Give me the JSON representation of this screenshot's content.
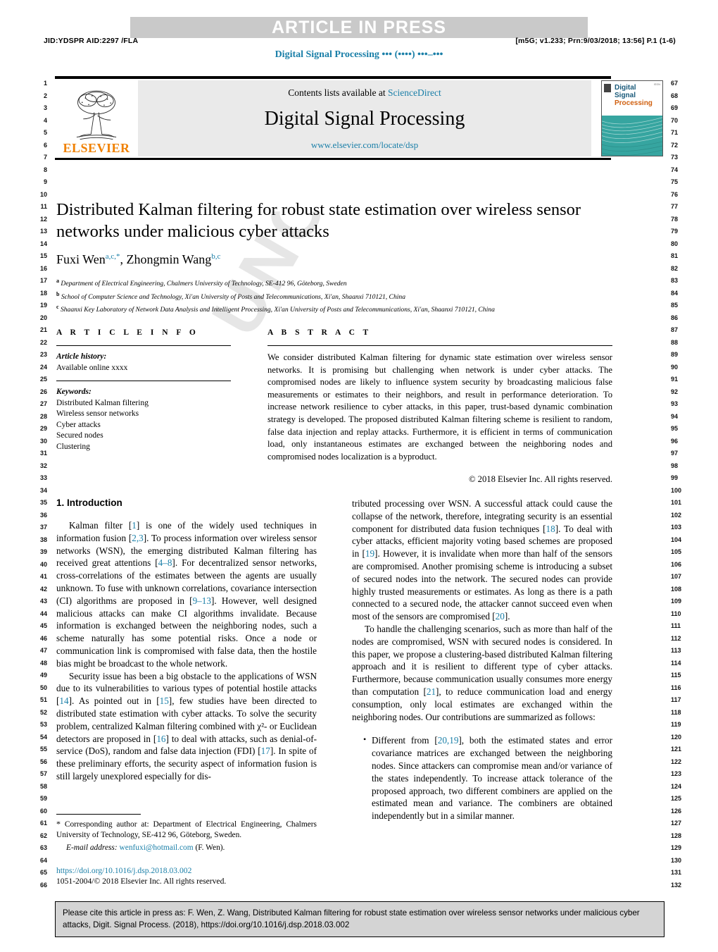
{
  "header": {
    "banner": "ARTICLE IN PRESS",
    "jid": "JID:YDSPR   AID:2297 /FLA",
    "prn": "[m5G; v1.233; Prn:9/03/2018; 13:56] P.1 (1-6)",
    "running_journal": "Digital Signal Processing ••• (••••) •••–•••"
  },
  "masthead": {
    "contents_prefix": "Contents lists available at ",
    "contents_link": "ScienceDirect",
    "journal_title": "Digital Signal Processing",
    "journal_url": "www.elsevier.com/locate/dsp",
    "publisher": "ELSEVIER",
    "cover_title_line1": "Digital",
    "cover_title_line2": "Signal",
    "cover_title_line3": "Processing",
    "cover_tag": "ISSN"
  },
  "title": "Distributed Kalman filtering for robust state estimation over wireless sensor networks under malicious cyber attacks",
  "authors": {
    "author1": "Fuxi Wen",
    "author1_sup": "a,c,*",
    "separator": ", ",
    "author2": "Zhongmin Wang",
    "author2_sup": "b,c"
  },
  "affiliations": [
    {
      "mark": "a",
      "text": "Department of Electrical Engineering, Chalmers University of Technology, SE-412 96, Göteborg, Sweden"
    },
    {
      "mark": "b",
      "text": "School of Computer Science and Technology, Xi'an University of Posts and Telecommunications, Xi'an, Shaanxi 710121, China"
    },
    {
      "mark": "c",
      "text": "Shaanxi Key Laboratory of Network Data Analysis and Intelligent Processing, Xi'an University of Posts and Telecommunications, Xi'an, Shaanxi 710121, China"
    }
  ],
  "article_info": {
    "label": "A R T I C L E   I N F O",
    "history_label": "Article history:",
    "history_value": "Available online xxxx",
    "keywords_label": "Keywords:",
    "keywords": [
      "Distributed Kalman filtering",
      "Wireless sensor networks",
      "Cyber attacks",
      "Secured nodes",
      "Clustering"
    ]
  },
  "abstract": {
    "label": "A B S T R A C T",
    "text": "We consider distributed Kalman filtering for dynamic state estimation over wireless sensor networks. It is promising but challenging when network is under cyber attacks. The compromised nodes are likely to influence system security by broadcasting malicious false measurements or estimates to their neighbors, and result in performance deterioration. To increase network resilience to cyber attacks, in this paper, trust-based dynamic combination strategy is developed. The proposed distributed Kalman filtering scheme is resilient to random, false data injection and replay attacks. Furthermore, it is efficient in terms of communication load, only instantaneous estimates are exchanged between the neighboring nodes and compromised nodes localization is a byproduct.",
    "copyright": "© 2018 Elsevier Inc. All rights reserved."
  },
  "body": {
    "section_heading": "1. Introduction",
    "left_paragraphs": [
      "Kalman filter [1] is one of the widely used techniques in information fusion [2,3]. To process information over wireless sensor networks (WSN), the emerging distributed Kalman filtering has received great attentions [4–8]. For decentralized sensor networks, cross-correlations of the estimates between the agents are usually unknown. To fuse with unknown correlations, covariance intersection (CI) algorithms are proposed in [9–13]. However, well designed malicious attacks can make CI algorithms invalidate. Because information is exchanged between the neighboring nodes, such a scheme naturally has some potential risks. Once a node or communication link is compromised with false data, then the hostile bias might be broadcast to the whole network.",
      "Security issue has been a big obstacle to the applications of WSN due to its vulnerabilities to various types of potential hostile attacks [14]. As pointed out in [15], few studies have been directed to distributed state estimation with cyber attacks. To solve the security problem, centralized Kalman filtering combined with χ²- or Euclidean detectors are proposed in [16] to deal with attacks, such as denial-of-service (DoS), random and false data injection (FDI) [17]. In spite of these preliminary efforts, the security aspect of information fusion is still largely unexplored especially for dis-"
    ],
    "right_paragraphs": [
      "tributed processing over WSN. A successful attack could cause the collapse of the network, therefore, integrating security is an essential component for distributed data fusion techniques [18]. To deal with cyber attacks, efficient majority voting based schemes are proposed in [19]. However, it is invalidate when more than half of the sensors are compromised. Another promising scheme is introducing a subset of secured nodes into the network. The secured nodes can provide highly trusted measurements or estimates. As long as there is a path connected to a secured node, the attacker cannot succeed even when most of the sensors are compromised [20].",
      "To handle the challenging scenarios, such as more than half of the nodes are compromised, WSN with secured nodes is considered. In this paper, we propose a clustering-based distributed Kalman filtering approach and it is resilient to different type of cyber attacks. Furthermore, because communication usually consumes more energy than computation [21], to reduce communication load and energy consumption, only local estimates are exchanged within the neighboring nodes. Our contributions are summarized as follows:"
    ],
    "bullets": [
      "Different from [20,19], both the estimated states and error covariance matrices are exchanged between the neighboring nodes. Since attackers can compromise mean and/or variance of the states independently. To increase attack tolerance of the proposed approach, two different combiners are applied on the estimated mean and variance. The combiners are obtained independently but in a similar manner."
    ]
  },
  "footnote": {
    "star": "*",
    "corresponding": "Corresponding author at: Department of Electrical Engineering, Chalmers University of Technology, SE-412 96, Göteborg, Sweden.",
    "email_label": "E-mail address:",
    "email": "wenfuxi@hotmail.com",
    "email_suffix": "(F. Wen).",
    "doi": "https://doi.org/10.1016/j.dsp.2018.03.002",
    "issn": "1051-2004/© 2018 Elsevier Inc. All rights reserved."
  },
  "cite_box": {
    "text": "Please cite this article in press as: F. Wen, Z. Wang, Distributed Kalman filtering for robust state estimation over wireless sensor networks under malicious cyber attacks, Digit. Signal Process. (2018), https://doi.org/10.1016/j.dsp.2018.03.002"
  },
  "line_numbers": {
    "left_start": 1,
    "left_end": 66,
    "right_start": 67,
    "right_end": 132
  },
  "watermark": "UNCORRECTED PROOF",
  "colors": {
    "link": "#1a7fa8",
    "elsevier_orange": "#f08000",
    "banner_gray": "#c9c9c9",
    "masthead_gray": "#eaeaea",
    "cite_gray": "#d4d4d4",
    "cover_teal": "#36a5a0"
  }
}
